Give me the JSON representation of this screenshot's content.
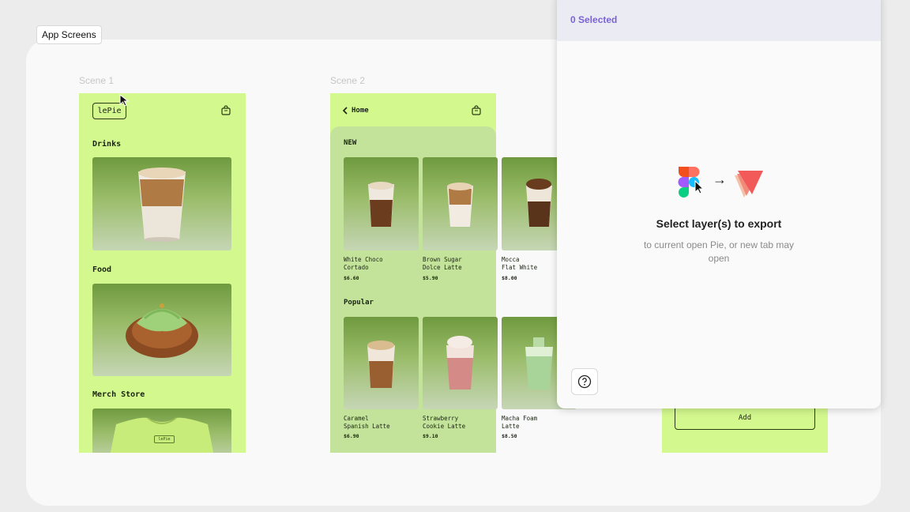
{
  "frame_label": "App Screens",
  "scenes": {
    "scene1": {
      "title": "Scene 1",
      "logo": "lePie",
      "sections": [
        "Drinks",
        "Food",
        "Merch Store"
      ],
      "merch_logo": "lePie"
    },
    "scene2": {
      "title": "Scene 2",
      "back_label": "Home",
      "new_title": "NEW",
      "popular_title": "Popular",
      "new_items": [
        {
          "name": "White Choco\nCortado",
          "price": "$6.60"
        },
        {
          "name": "Brown Sugar\nDolce Latte",
          "price": "$5.90"
        },
        {
          "name": "Mocca\nFlat White",
          "price": "$8.00"
        }
      ],
      "popular_items": [
        {
          "name": "Caramel\nSpanish Latte",
          "price": "$6.90"
        },
        {
          "name": "Strawberry\nCookie Latte",
          "price": "$9.10"
        },
        {
          "name": "Macha Foam\nLatte",
          "price": "$8.50"
        }
      ]
    },
    "scene3": {
      "add_label": "Add"
    }
  },
  "plugin": {
    "selected_count": "0 Selected",
    "title": "Select layer(s) to export",
    "subtitle": "to current open Pie, or new tab may open",
    "arrow": "→"
  },
  "colors": {
    "screen_bg": "#d3f88e",
    "accent": "#7b62d6",
    "pie_red": "#f25a5a"
  },
  "icons": [
    "bag-icon",
    "chevron-left-icon",
    "figma-logo-icon",
    "pie-logo-icon",
    "help-icon",
    "cursor-icon"
  ]
}
